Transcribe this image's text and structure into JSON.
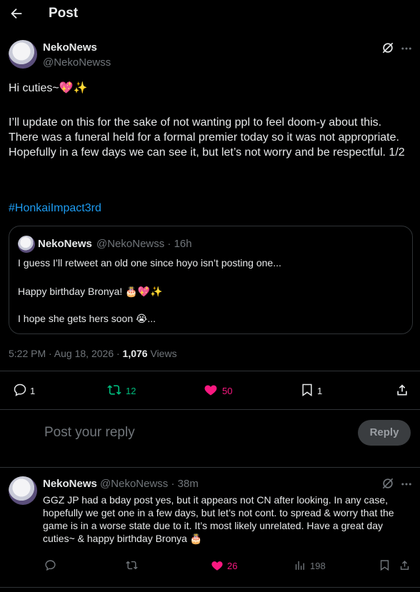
{
  "header": {
    "title": "Post"
  },
  "post": {
    "author_name": "NekoNews",
    "author_handle": "@NekoNewss",
    "greeting": "Hi cuties~💖✨",
    "body": "I’ll update on this for the sake of not wanting ppl to feel doom-y about this. There was a funeral held for a formal premier today so it was not appropriate. Hopefully in a few days we can see it, but let’s not worry and be respectful. 1/2",
    "hashtag": "#HonkaiImpact3rd",
    "timestamp": "5:22 PM · Aug 18, 2026 · ",
    "views_count": "1,076",
    "views_label": " Views",
    "stats": {
      "replies": "1",
      "reposts": "12",
      "likes": "50",
      "bookmarks": "1"
    },
    "colors": {
      "repost": "#00ba7c",
      "like": "#f91880"
    }
  },
  "quote": {
    "author_name": "NekoNews",
    "author_meta": "@NekoNewss · 16h",
    "line1": "I guess I’ll retweet an old one since hoyo isn’t posting one...",
    "line2": "Happy birthday Bronya! 🎂💖✨",
    "line3": "I hope she gets hers soon 😭..."
  },
  "composer": {
    "placeholder": "Post your reply",
    "button": "Reply"
  },
  "reply": {
    "author_name": "NekoNews",
    "author_meta": "@NekoNewss · 38m",
    "body": "GGZ JP had a bday post yes, but it appears not CN after looking. In any case, hopefully we get one in a few days, but let’s not cont. to spread & worry that the game is in a worse state due to it. It’s most likely unrelated. Have a great day cuties~ & happy birthday Bronya 🎂",
    "stats": {
      "likes": "26",
      "views": "198"
    }
  },
  "icons": [
    "back-arrow-icon",
    "grok-icon",
    "more-icon",
    "reply-icon",
    "repost-icon",
    "heart-icon",
    "bookmark-icon",
    "share-icon",
    "views-icon"
  ]
}
